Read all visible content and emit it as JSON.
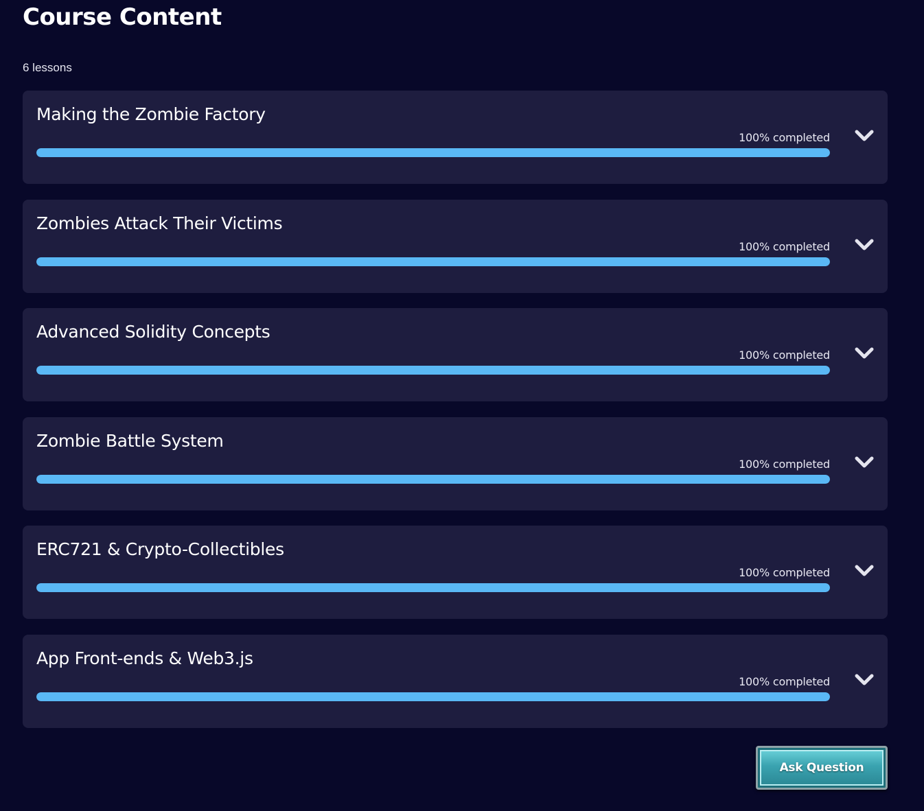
{
  "page_title": "Course Content",
  "lesson_count": "6 lessons",
  "accent_color": "#5ab8f5",
  "lessons": [
    {
      "title": "Making the Zombie Factory",
      "progress_label": "100% completed",
      "progress": 1.0,
      "icon": "chevron-down-icon"
    },
    {
      "title": "Zombies Attack Their Victims",
      "progress_label": "100% completed",
      "progress": 1.0,
      "icon": "chevron-down-icon"
    },
    {
      "title": "Advanced Solidity Concepts",
      "progress_label": "100% completed",
      "progress": 1.0,
      "icon": "chevron-down-icon"
    },
    {
      "title": "Zombie Battle System",
      "progress_label": "100% completed",
      "progress": 1.0,
      "icon": "chevron-down-icon"
    },
    {
      "title": "ERC721 & Crypto-Collectibles",
      "progress_label": "100% completed",
      "progress": 1.0,
      "icon": "chevron-down-icon"
    },
    {
      "title": "App Front-ends & Web3.js",
      "progress_label": "100% completed",
      "progress": 1.0,
      "icon": "chevron-down-icon"
    }
  ],
  "ask_button": {
    "label": "Ask Question"
  }
}
